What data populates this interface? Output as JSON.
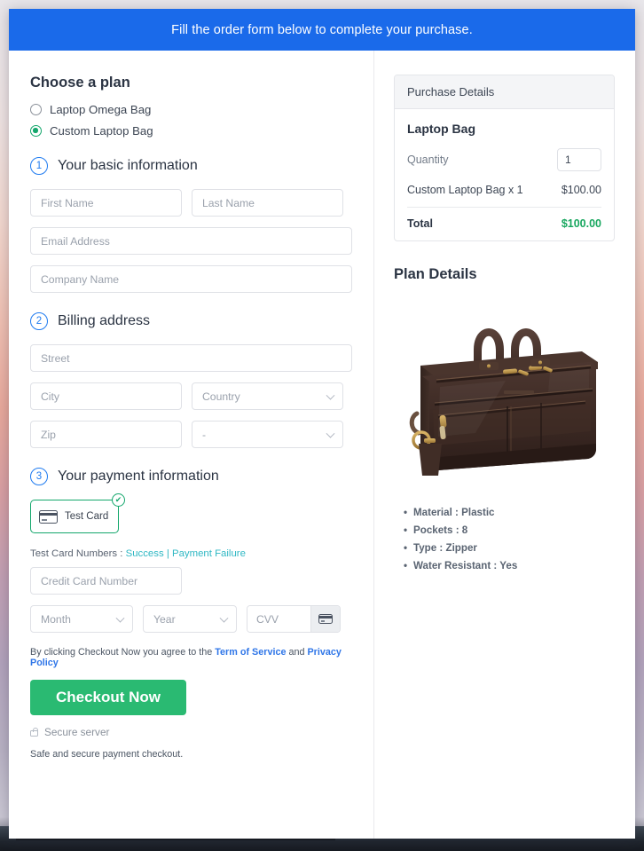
{
  "banner": {
    "text": "Fill the order form below to complete your purchase."
  },
  "plan": {
    "heading": "Choose a plan",
    "options": [
      {
        "label": "Laptop Omega Bag",
        "selected": false
      },
      {
        "label": "Custom Laptop Bag",
        "selected": true
      }
    ]
  },
  "steps": {
    "basic": {
      "num": "1",
      "label": "Your basic information"
    },
    "billing": {
      "num": "2",
      "label": "Billing address"
    },
    "payment": {
      "num": "3",
      "label": "Your payment information"
    }
  },
  "basic_fields": {
    "first_name": "First Name",
    "last_name": "Last Name",
    "email": "Email Address",
    "company": "Company Name"
  },
  "billing_fields": {
    "street": "Street",
    "city": "City",
    "country": "Country",
    "zip": "Zip",
    "state": "-"
  },
  "payment": {
    "tile_label": "Test  Card",
    "tile_icon": "credit-card-icon",
    "tile_badge": "✔",
    "test_prefix": "Test Card Numbers : ",
    "test_success": "Success",
    "test_sep": " | ",
    "test_failure": "Payment Failure",
    "card_number": "Credit Card Number",
    "month": "Month",
    "year": "Year",
    "cvv": "CVV"
  },
  "agreement": {
    "prefix": "By clicking Checkout Now you agree to the ",
    "terms": "Term of Service",
    "and": " and ",
    "privacy": "Privacy Policy"
  },
  "checkout": {
    "button": "Checkout Now",
    "secure_server": "Secure server",
    "safe_note": "Safe and secure payment checkout."
  },
  "purchase": {
    "header": "Purchase Details",
    "product": "Laptop Bag",
    "quantity_label": "Quantity",
    "quantity_value": "1",
    "line_label": "Custom Laptop Bag x 1",
    "line_amount": "$100.00",
    "total_label": "Total",
    "total_amount": "$100.00"
  },
  "plan_details": {
    "title": "Plan Details",
    "image_alt": "brown-leather-laptop-bag",
    "features": [
      "Material : Plastic",
      "Pockets : 8",
      "Type : Zipper",
      "Water Resistant : Yes"
    ]
  },
  "colors": {
    "banner_blue": "#1a6aea",
    "accent_green": "#2aba72",
    "total_green": "#18a75f",
    "step_blue": "#1f7bf0",
    "link_blue": "#2f76e8",
    "link_teal": "#30b8c4"
  }
}
